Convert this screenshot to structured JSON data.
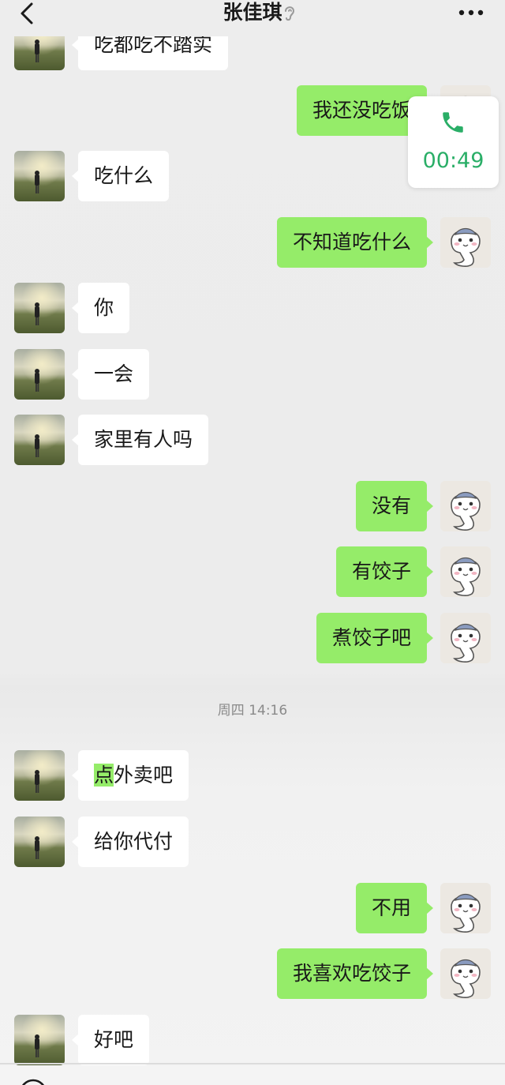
{
  "header": {
    "title": "张佳琪",
    "back_icon": "chevron-left-icon",
    "ear_icon": "ear-icon",
    "more_icon": "more-dots-icon"
  },
  "call": {
    "duration": "00:49",
    "icon": "phone-icon",
    "color": "#2aae67"
  },
  "colors": {
    "outgoing_bubble": "#95ec69",
    "incoming_bubble": "#ffffff",
    "background": "#ededed"
  },
  "messages": [
    {
      "dir": "in",
      "text": "吃都吃不踏实"
    },
    {
      "dir": "out",
      "text": "我还没吃饭"
    },
    {
      "dir": "in",
      "text": "吃什么"
    },
    {
      "dir": "out",
      "text": "不知道吃什么"
    },
    {
      "dir": "in",
      "text": "你"
    },
    {
      "dir": "in",
      "text": "一会"
    },
    {
      "dir": "in",
      "text": "家里有人吗"
    },
    {
      "dir": "out",
      "text": "没有"
    },
    {
      "dir": "out",
      "text": "有饺子"
    },
    {
      "dir": "out",
      "text": "煮饺子吧"
    },
    {
      "dir": "in",
      "text_highlight": "点",
      "text_rest": "外卖吧"
    },
    {
      "dir": "in",
      "text": "给你代付"
    },
    {
      "dir": "out",
      "text": "不用"
    },
    {
      "dir": "out",
      "text": "我喜欢吃饺子"
    },
    {
      "dir": "in",
      "text": "好吧"
    }
  ],
  "timestamp": "周四 14:16"
}
